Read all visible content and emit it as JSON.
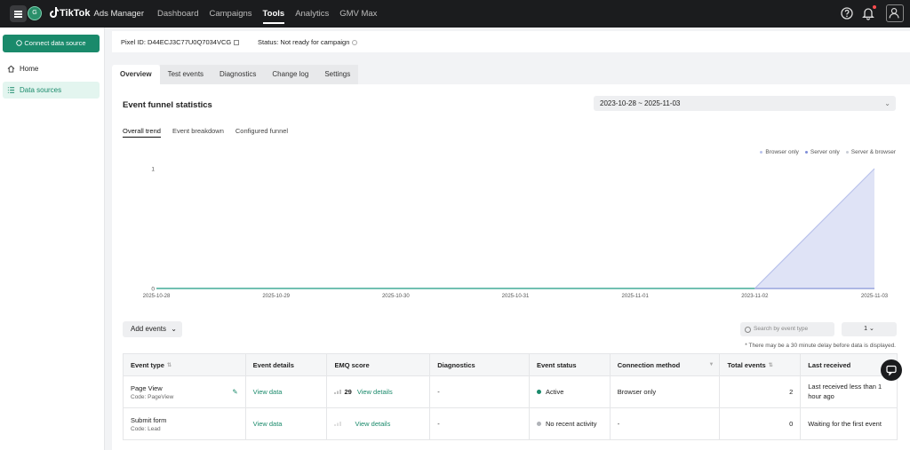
{
  "app": {
    "brand": "TikTok",
    "brand_sub": "Ads Manager",
    "account_initial": "G"
  },
  "nav": [
    {
      "label": "Dashboard"
    },
    {
      "label": "Campaigns"
    },
    {
      "label": "Tools",
      "active": true
    },
    {
      "label": "Analytics"
    },
    {
      "label": "GMV Max"
    }
  ],
  "sidebar": {
    "connect_label": "Connect data source",
    "items": [
      {
        "label": "Home",
        "icon": "home-icon"
      },
      {
        "label": "Data sources",
        "icon": "list-icon",
        "active": true
      }
    ]
  },
  "pixel": {
    "id_label": "Pixel ID: D44ECJ3C77U0Q7034VCG",
    "status_label": "Status: Not ready for campaign"
  },
  "tabs": [
    {
      "label": "Overview",
      "active": true
    },
    {
      "label": "Test events"
    },
    {
      "label": "Diagnostics"
    },
    {
      "label": "Change log"
    },
    {
      "label": "Settings"
    }
  ],
  "funnel": {
    "title": "Event funnel statistics",
    "date_range": "2023-10-28 ~ 2025-11-03",
    "subtabs": [
      "Overall trend",
      "Event breakdown",
      "Configured funnel"
    ]
  },
  "chart_data": {
    "type": "area",
    "x": [
      "2025-10-28",
      "2025-10-29",
      "2025-10-30",
      "2025-10-31",
      "2025-11-01",
      "2023-11-02",
      "2025-11-03"
    ],
    "series": [
      {
        "name": "Browser only",
        "values": [
          0,
          0,
          0,
          0,
          0,
          0,
          1
        ],
        "color": "#b9c2ec"
      },
      {
        "name": "Server only",
        "values": [
          0,
          0,
          0,
          0,
          0,
          0,
          0
        ],
        "color": "#7f8ed8"
      },
      {
        "name": "Server & browser",
        "values": [
          0,
          0,
          0,
          0,
          0,
          0,
          0
        ],
        "color": "#c9cdd6"
      }
    ],
    "yticks": [
      "0",
      "1"
    ],
    "ylim": [
      0,
      1
    ],
    "grid": false,
    "legend": "top-right"
  },
  "events": {
    "add_label": "Add events",
    "search_placeholder": "Search by event type",
    "page": "1",
    "note": "* There may be a 30 minute delay before data is displayed.",
    "columns": [
      "Event type",
      "Event details",
      "EMQ score",
      "Diagnostics",
      "Event status",
      "Connection method",
      "Total events",
      "Last received"
    ],
    "rows": [
      {
        "type": "Page View",
        "code": "Code: PageView",
        "details": "View data",
        "emq": "29",
        "emq_link": "View details",
        "diagnostics": "-",
        "status": "Active",
        "status_color": "#1a8a6b",
        "method": "Browser only",
        "total": "2",
        "last": "Last received less than 1 hour ago"
      },
      {
        "type": "Submit form",
        "code": "Code: Lead",
        "details": "View data",
        "emq": "",
        "emq_link": "View details",
        "diagnostics": "-",
        "status": "No recent activity",
        "status_color": "#b0b3b8",
        "method": "-",
        "total": "0",
        "last": "Waiting for the first event"
      }
    ]
  }
}
